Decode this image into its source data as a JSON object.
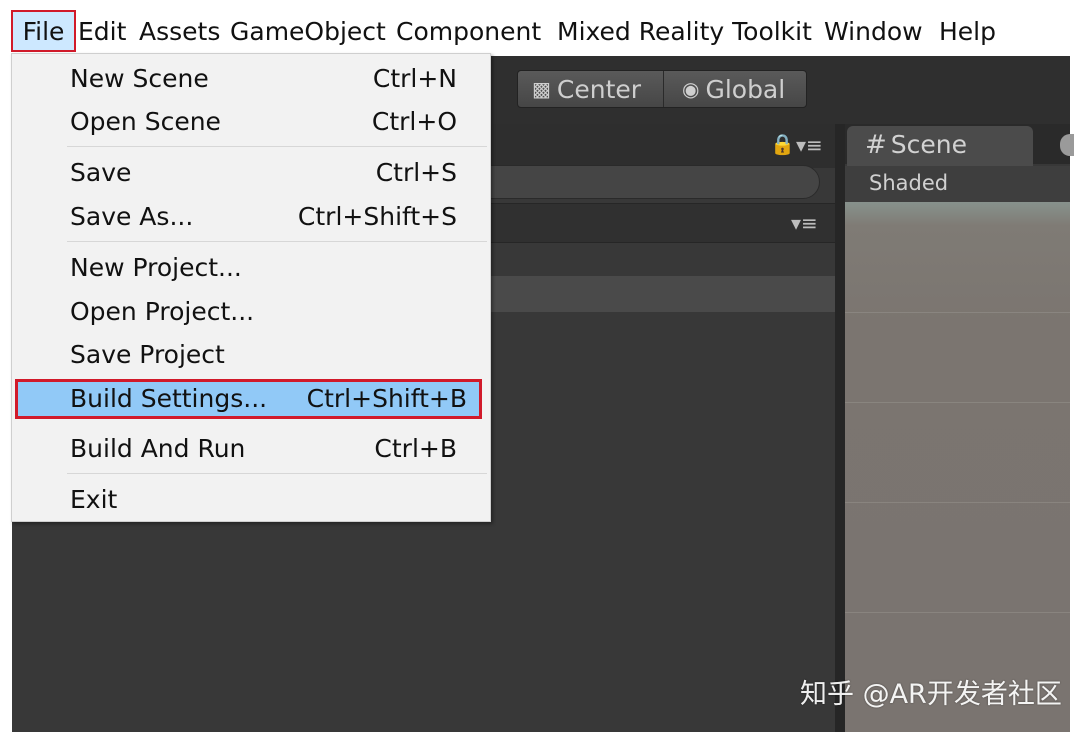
{
  "menubar": {
    "items": [
      "File",
      "Edit",
      "Assets",
      "GameObject",
      "Component",
      "Mixed Reality Toolkit",
      "Window",
      "Help"
    ]
  },
  "toolbar": {
    "center_label": "Center",
    "global_label": "Global"
  },
  "scene": {
    "tab_label": "Scene",
    "shading_mode": "Shaded"
  },
  "file_menu": {
    "items": [
      {
        "label": "New Scene",
        "shortcut": "Ctrl+N"
      },
      {
        "label": "Open Scene",
        "shortcut": "Ctrl+O"
      },
      {
        "label": "Save",
        "shortcut": "Ctrl+S"
      },
      {
        "label": "Save As...",
        "shortcut": "Ctrl+Shift+S"
      },
      {
        "label": "New Project...",
        "shortcut": ""
      },
      {
        "label": "Open Project...",
        "shortcut": ""
      },
      {
        "label": "Save Project",
        "shortcut": ""
      },
      {
        "label": "Build Settings...",
        "shortcut": "Ctrl+Shift+B"
      },
      {
        "label": "Build And Run",
        "shortcut": "Ctrl+B"
      },
      {
        "label": "Exit",
        "shortcut": ""
      }
    ]
  },
  "watermark": {
    "text": "知乎 @AR开发者社区"
  },
  "colors": {
    "highlight": "#91c9f7",
    "annotation_red": "#d11a2a",
    "editor_dark": "#383838"
  }
}
